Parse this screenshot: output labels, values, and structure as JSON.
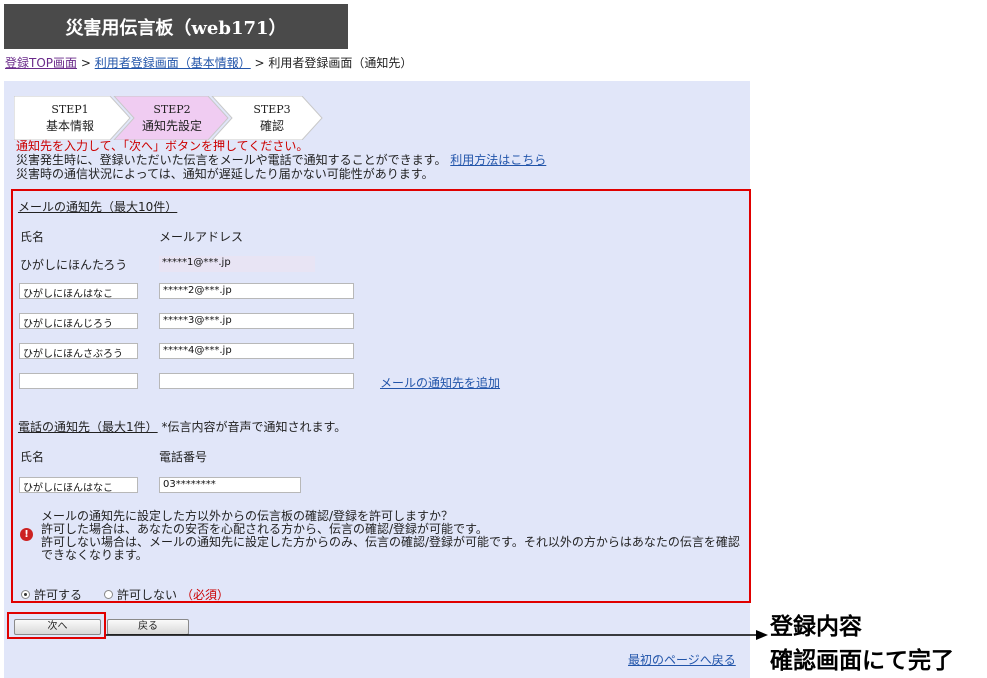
{
  "header": {
    "title": "災害用伝言板（web171）"
  },
  "breadcrumb": {
    "item1": "登録TOP画面",
    "sep1": " > ",
    "item2": "利用者登録画面（基本情報）",
    "sep2": " > ",
    "item3": "利用者登録画面（通知先）"
  },
  "steps": [
    {
      "num": "STEP1",
      "label": "基本情報"
    },
    {
      "num": "STEP2",
      "label": "通知先設定"
    },
    {
      "num": "STEP3",
      "label": "確認"
    }
  ],
  "notice": {
    "line1": "通知先を入力して、「次へ」ボタンを押してください。",
    "line2": "災害発生時に、登録いただいた伝言をメールや電話で通知することができます。",
    "help_link": "利用方法はこちら",
    "line3": "災害時の通信状況によっては、通知が遅延したり届かない可能性があります。"
  },
  "mail_section": {
    "title": "メールの通知先（最大10件）",
    "col_name": "氏名",
    "col_address": "メールアドレス",
    "owner_name": "ひがしにほんたろう",
    "owner_address": "*****1@***.jp",
    "rows": [
      {
        "name": "ひがしにほんはなこ",
        "address": "*****2@***.jp"
      },
      {
        "name": "ひがしにほんじろう",
        "address": "*****3@***.jp"
      },
      {
        "name": "ひがしにほんさぶろう",
        "address": "*****4@***.jp"
      },
      {
        "name": "",
        "address": ""
      }
    ],
    "add_link": "メールの通知先を追加"
  },
  "phone_section": {
    "title": "電話の通知先（最大1件）",
    "note": "*伝言内容が音声で通知されます。",
    "col_name": "氏名",
    "col_phone": "電話番号",
    "name": "ひがしにほんはなこ",
    "phone": "03********"
  },
  "permission": {
    "icon": "warning-icon",
    "line1": "メールの通知先に設定した方以外からの伝言板の確認/登録を許可しますか？",
    "line2": "許可した場合は、あなたの安否を心配される方から、伝言の確認/登録が可能です。",
    "line3": "許可しない場合は、メールの通知先に設定した方からのみ、伝言の確認/登録が可能です。それ以外の方からはあなたの伝言を確認できなくなります。",
    "allow": "許可する",
    "deny": "許可しない",
    "required": "（必須）",
    "selected": "allow"
  },
  "buttons": {
    "next": "次へ",
    "back": "戻る"
  },
  "footer": {
    "first_page_link": "最初のページへ戻る"
  },
  "annotation": {
    "line1": "登録内容",
    "line2": "確認画面にて完了"
  }
}
